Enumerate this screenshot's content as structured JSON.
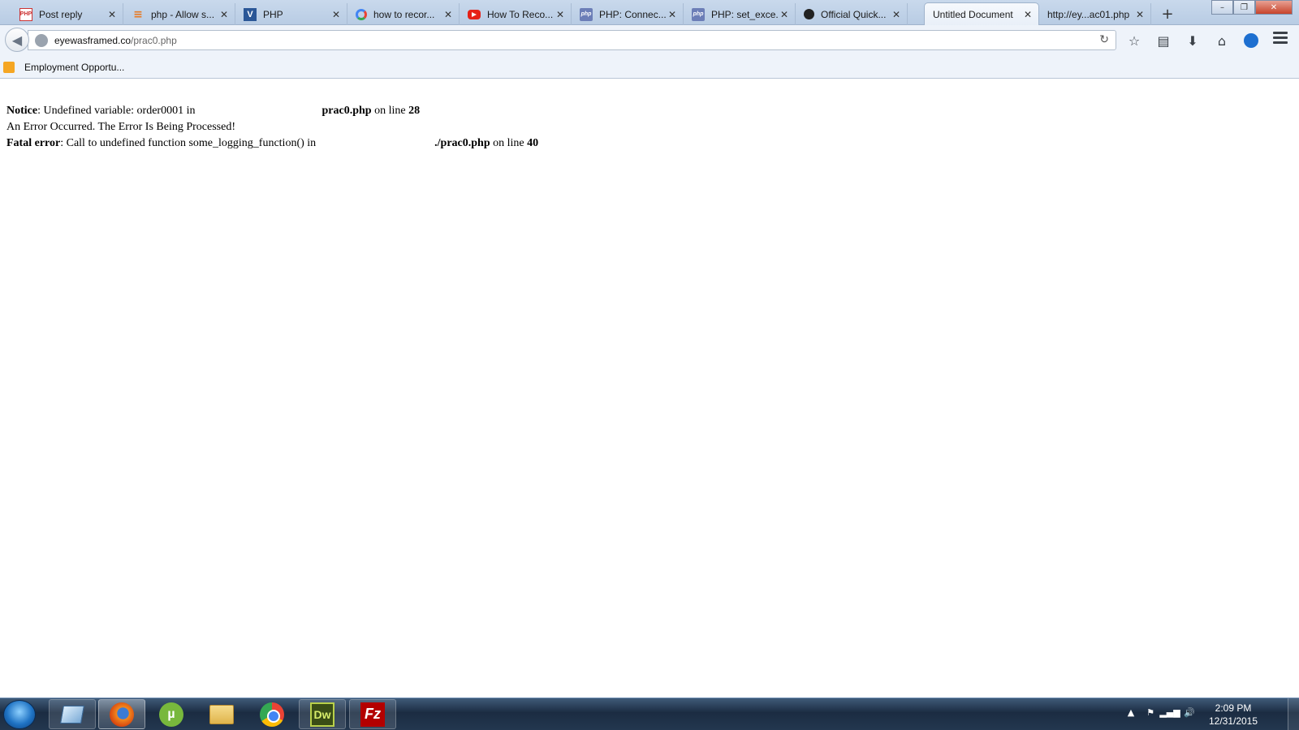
{
  "tabs": [
    {
      "title": "Post reply",
      "icon": "phpbb-icon",
      "active": false
    },
    {
      "title": "php - Allow s...",
      "icon": "stackoverflow-icon",
      "active": false
    },
    {
      "title": "PHP",
      "icon": "v-logo-icon",
      "active": false
    },
    {
      "title": "how to recor...",
      "icon": "google-icon",
      "active": false
    },
    {
      "title": "How To Reco...",
      "icon": "youtube-icon",
      "active": false
    },
    {
      "title": "PHP: Connec...",
      "icon": "php-icon",
      "active": false
    },
    {
      "title": "PHP: set_exce...",
      "icon": "php-icon",
      "active": false
    },
    {
      "title": "Official Quick...",
      "icon": "obs-icon",
      "active": false
    },
    {
      "title": "Untitled Document",
      "icon": "",
      "active": true
    },
    {
      "title": "http://ey...ac01.php",
      "icon": "",
      "active": false
    }
  ],
  "window_controls": {
    "minimize": "–",
    "restore": "❐",
    "close": "✕"
  },
  "new_tab_label": "+",
  "navbar": {
    "url_host": "eyewasframed.co",
    "url_path": "/prac0.php"
  },
  "bookmarks": [
    {
      "label": "Employment Opportu..."
    }
  ],
  "content": {
    "line1": {
      "label": "Notice",
      "text": ": Undefined variable: order0001 in",
      "file": "prac0.php",
      "mid": " on line ",
      "line": "28"
    },
    "line2": "An Error Occurred. The Error Is Being Processed!",
    "line3": {
      "label": "Fatal error",
      "text": ": Call to undefined function some_logging_function() in",
      "file": "./prac0.php",
      "mid": " on line ",
      "line": "40"
    }
  },
  "taskbar": {
    "apps": [
      {
        "name": "Windows Explorer",
        "icon": "explorer-window-icon",
        "state": "open"
      },
      {
        "name": "Firefox",
        "icon": "firefox-icon",
        "state": "active"
      },
      {
        "name": "uTorrent",
        "icon": "utorrent-icon",
        "state": "pinned",
        "glyph": "µ"
      },
      {
        "name": "Libraries",
        "icon": "folder-icon",
        "state": "pinned"
      },
      {
        "name": "Google Chrome",
        "icon": "chrome-icon",
        "state": "pinned"
      },
      {
        "name": "Dreamweaver",
        "icon": "dreamweaver-icon",
        "state": "open",
        "glyph": "Dw"
      },
      {
        "name": "FileZilla",
        "icon": "filezilla-icon",
        "state": "open",
        "glyph": "Fz"
      }
    ],
    "clock_time": "2:09 PM",
    "clock_date": "12/31/2015"
  }
}
